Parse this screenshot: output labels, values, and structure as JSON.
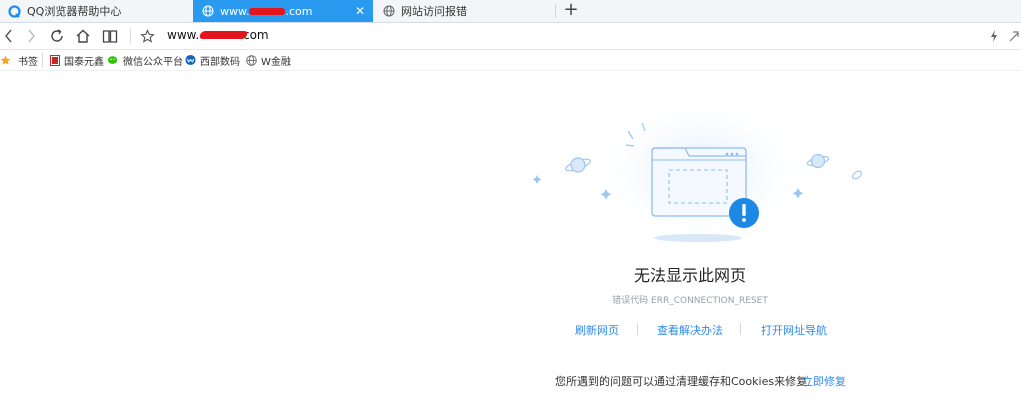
{
  "tabs": [
    {
      "title": "QQ浏览器帮助中心",
      "active": false
    },
    {
      "title": "www.███.com",
      "active": true
    },
    {
      "title": "网站访问报错",
      "active": false
    }
  ],
  "new_tab_label": "+",
  "address": {
    "url_prefix": "www.",
    "url_suffix": ".com"
  },
  "bookmarks": [
    {
      "label": "书签",
      "icon": "star-icon"
    },
    {
      "label": "国泰元鑫",
      "icon": "bookmark-red-icon"
    },
    {
      "label": "微信公众平台",
      "icon": "wechat-icon"
    },
    {
      "label": "西部数码",
      "icon": "west-digital-icon"
    },
    {
      "label": "W金融",
      "icon": "globe-icon"
    }
  ],
  "error": {
    "title": "无法显示此网页",
    "code": "错误代码 ERR_CONNECTION_RESET",
    "actions": [
      "刷新网页",
      "查看解决办法",
      "打开网址导航"
    ],
    "hint": "您所遇到的问题可以通过清理缓存和Cookies来修复",
    "fix_label": "立即修复"
  },
  "colors": {
    "accent": "#2a9af0",
    "link": "#2f8be6",
    "redaction": "#e3141b",
    "alert": "#1e88e5"
  }
}
